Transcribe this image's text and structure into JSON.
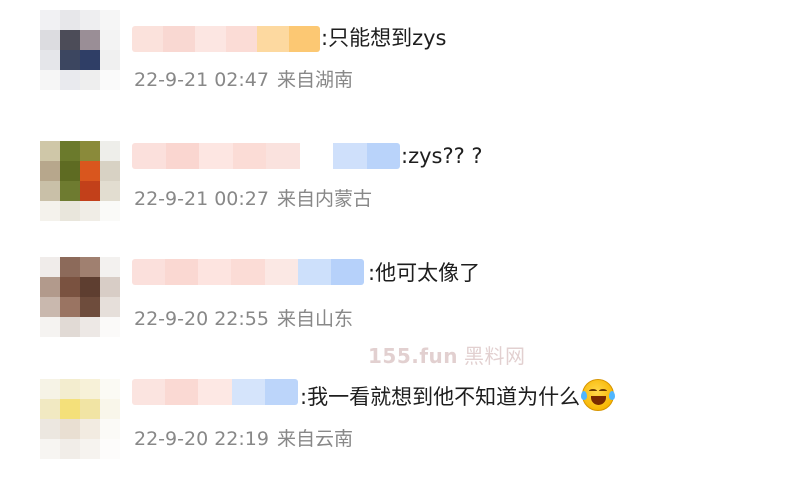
{
  "watermark": {
    "site": "155.fun",
    "label": "黑料网"
  },
  "comments": [
    {
      "text": ":只能想到zys",
      "time": "22-9-21 02:47",
      "location": "来自湖南"
    },
    {
      "text": ":zys?? ?",
      "time": "22-9-21 00:27",
      "location": "来自内蒙古"
    },
    {
      "text": ":他可太像了",
      "time": "22-9-20 22:55",
      "location": "来自山东"
    },
    {
      "text": ":我一看就想到他不知道为什么",
      "time": "22-9-20 22:19",
      "location": "来自云南",
      "emoji": "laugh-cry-emoji"
    }
  ]
}
